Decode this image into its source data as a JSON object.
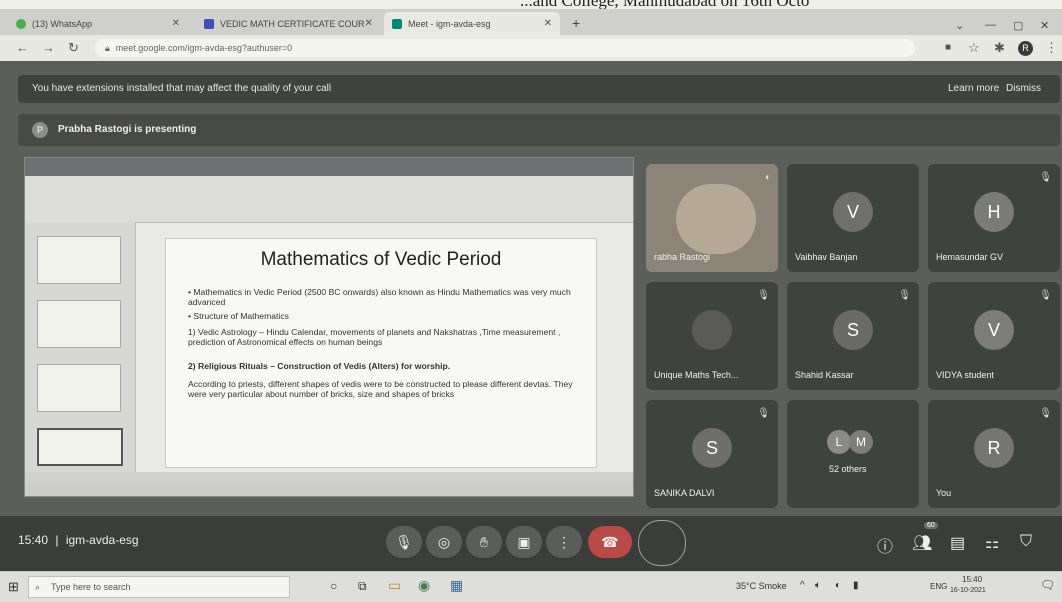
{
  "page_caption": "...and College, Mahmudabad on 16th Octo",
  "browser": {
    "tabs": [
      {
        "label": "(13) WhatsApp",
        "icon": "whatsapp-icon",
        "color": "#4caf50"
      },
      {
        "label": "VEDIC MATH CERTIFICATE COUR",
        "icon": "document-icon",
        "color": "#3f51b5"
      },
      {
        "label": "Meet - igm-avda-esg",
        "icon": "meet-icon",
        "color": "#00897b"
      }
    ],
    "new_tab": "+",
    "url": "meet.google.com/igm-avda-esg?authuser=0",
    "profile_initial": "R"
  },
  "meet": {
    "extension_warning": "You have extensions installed that may affect the quality of your call",
    "learn_more": "Learn more",
    "dismiss": "Dismiss",
    "presenter_banner": "Prabha Rastogi is presenting",
    "presenter_initial": "P",
    "slide": {
      "title": "Mathematics of Vedic Period",
      "bullet1": "• Mathematics in Vedic Period (2500 BC  onwards) also known as Hindu Mathematics was very much advanced",
      "bullet2": "• Structure of Mathematics",
      "item1": "1)  Vedic Astrology – Hindu Calendar, movements of planets and Nakshatras ,Time measurement , prediction of Astronomical effects on human beings",
      "item2": "2)  Religious Rituals – Construction of Vedis (Alters) for worship.",
      "para": "According to priests, different shapes of vedis were to be constructed to please different devtas. They were very particular about number of bricks, size and shapes of bricks"
    },
    "participants": [
      {
        "name": "rabha Rastogi",
        "initial": "",
        "color": "#9a8a7a"
      },
      {
        "name": "Vaibhav Banjan",
        "initial": "V",
        "color": "#6f6f6c"
      },
      {
        "name": "Hemasundar GV",
        "initial": "H",
        "color": "#7b7b78"
      },
      {
        "name": "Unique Maths Tech...",
        "initial": "",
        "color": "#5a5a57"
      },
      {
        "name": "Shahid Kassar",
        "initial": "S",
        "color": "#6a6a66"
      },
      {
        "name": "VIDYA student",
        "initial": "V",
        "color": "#7c7c79"
      },
      {
        "name": "SANIKA DALVI",
        "initial": "S",
        "color": "#6e6e6b"
      },
      {
        "name": "52 others",
        "initial": "",
        "color": "#6e6e6b"
      },
      {
        "name": "You",
        "initial": "R",
        "color": "#757572"
      }
    ],
    "others_initials": [
      "L",
      "M"
    ],
    "time": "15:40",
    "separator": "|",
    "meeting_code": "igm-avda-esg",
    "people_count": "60"
  },
  "taskbar": {
    "search_placeholder": "Type here to search",
    "weather": "35°C  Smoke",
    "lang": "ENG",
    "clock_time": "15:40",
    "clock_date": "16-10-2021"
  }
}
